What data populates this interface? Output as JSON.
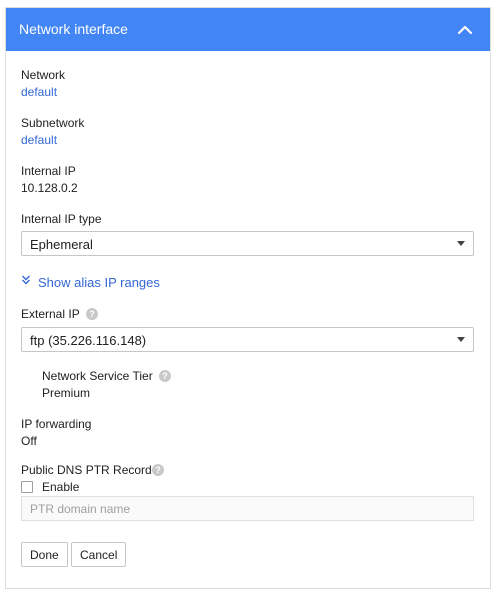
{
  "header": {
    "title": "Network interface"
  },
  "network": {
    "label": "Network",
    "value": "default"
  },
  "subnetwork": {
    "label": "Subnetwork",
    "value": "default"
  },
  "internal_ip": {
    "label": "Internal IP",
    "value": "10.128.0.2"
  },
  "internal_ip_type": {
    "label": "Internal IP type",
    "selected": "Ephemeral"
  },
  "alias": {
    "label": "Show alias IP ranges"
  },
  "external_ip": {
    "label": "External IP",
    "selected": "ftp (35.226.116.148)"
  },
  "service_tier": {
    "label": "Network Service Tier",
    "value": "Premium"
  },
  "ip_forwarding": {
    "label": "IP forwarding",
    "value": "Off"
  },
  "dns_ptr": {
    "label": "Public DNS PTR Record",
    "enable_label": "Enable",
    "enabled": false,
    "placeholder": "PTR domain name"
  },
  "actions": {
    "done_label": "Done",
    "cancel_label": "Cancel"
  },
  "colors": {
    "header_bg": "#4285f4",
    "link": "#3367d6"
  }
}
